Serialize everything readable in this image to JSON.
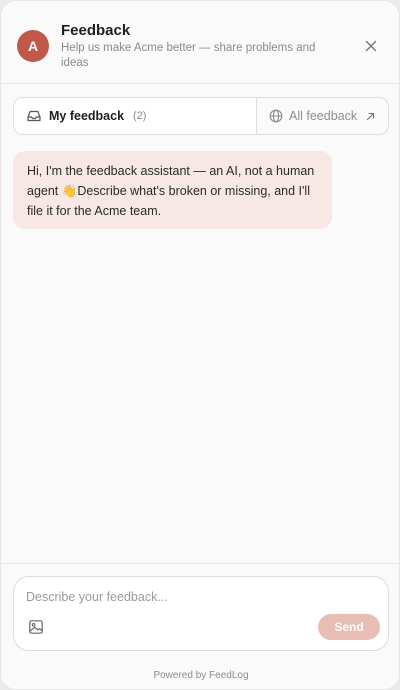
{
  "header": {
    "avatar_letter": "A",
    "title": "Feedback",
    "subtitle": "Help us make Acme better — share problems and ideas",
    "close_icon": "close-icon"
  },
  "tabs": {
    "my_feedback": {
      "label": "My feedback",
      "count": "(2)",
      "icon": "inbox-icon"
    },
    "all_feedback": {
      "label": "All feedback",
      "icon": "globe-icon",
      "trailing_icon": "external-link-icon"
    }
  },
  "messages": [
    {
      "role": "assistant",
      "text": "Hi, I'm the feedback assistant — an AI, not a human agent 👋Describe what's broken or missing, and I'll file it for the Acme team."
    }
  ],
  "composer": {
    "placeholder": "Describe your feedback...",
    "value": "",
    "image_icon": "image-icon",
    "send_label": "Send"
  },
  "footer": {
    "powered_by": "Powered by FeedLog"
  },
  "colors": {
    "accent": "#c1594a",
    "bubble_bg": "#f7e8e5",
    "send_disabled": "#e8bdb4"
  }
}
